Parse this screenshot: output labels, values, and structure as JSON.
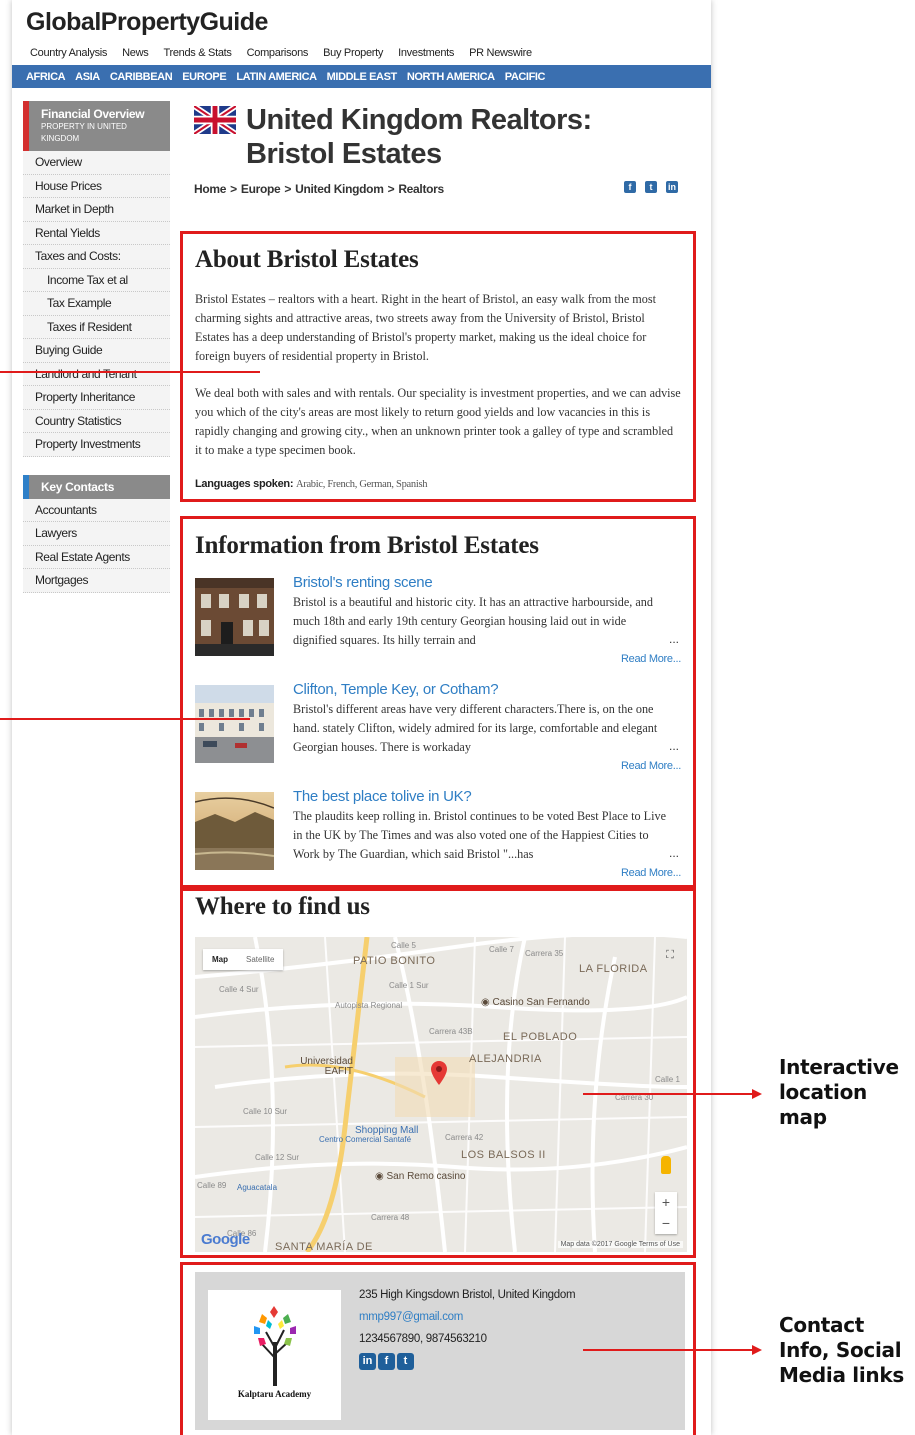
{
  "site": {
    "logo": "GlobalPropertyGuide"
  },
  "top_nav": [
    "Country Analysis",
    "News",
    "Trends & Stats",
    "Comparisons",
    "Buy Property",
    "Investments",
    "PR Newswire"
  ],
  "regions": [
    "AFRICA",
    "ASIA",
    "CARIBBEAN",
    "EUROPE",
    "LATIN AMERICA",
    "MIDDLE EAST",
    "NORTH AMERICA",
    "PACIFIC"
  ],
  "sidebar": {
    "financial_title": "Financial Overview",
    "financial_sub": "PROPERTY IN UNITED KINGDOM",
    "items": [
      "Overview",
      "House Prices",
      "Market in Depth",
      "Rental Yields",
      "Taxes and Costs:",
      "Income Tax et al",
      "Tax Example",
      "Taxes if Resident",
      "Buying Guide",
      "Landlord and Tenant",
      "Property Inheritance",
      "Country Statistics",
      "Property Investments"
    ],
    "contacts_title": "Key Contacts",
    "contacts": [
      "Accountants",
      "Lawyers",
      "Real Estate Agents",
      "Mortgages"
    ]
  },
  "page": {
    "title": "United Kingdom Realtors: Bristol Estates",
    "breadcrumb": [
      "Home",
      ">",
      "Europe",
      ">",
      "United Kingdom",
      ">",
      "Realtors"
    ],
    "share_icons": [
      "facebook-icon",
      "twitter-icon",
      "linkedin-icon"
    ]
  },
  "about": {
    "heading": "About Bristol Estates",
    "p1": "Bristol Estates – realtors with a heart. Right in the heart of Bristol, an easy walk from the most charming sights and attractive areas, two streets away from the University of Bristol, Bristol Estates has a deep understanding of Bristol's property market, making us the ideal choice for foreign buyers of residential property in Bristol.",
    "p2": "We deal both with sales and with rentals. Our speciality is investment properties, and we can advise you which of the city's areas are most likely to return good yields and low vacancies in this is rapidly changing and growing city., when an unknown printer took a galley of type and scrambled it to make a type specimen book.",
    "languages_label": "Languages spoken:",
    "languages": "Arabic, French, German, Spanish"
  },
  "info": {
    "heading": "Information from Bristol Estates",
    "articles": [
      {
        "title": "Bristol's renting scene",
        "text": "Bristol is a beautiful and historic city.  It has an attractive harbourside, and much 18th and early 19th century Georgian housing laid out in wide dignified squares. Its hilly terrain and",
        "dots": "...",
        "more": "Read More..."
      },
      {
        "title": "Clifton, Temple Key, or Cotham?",
        "text": "Bristol's different areas have very different characters.There is, on the one hand. stately Clifton, widely admired for its large, comfortable and elegant Georgian houses.  There is workaday",
        "dots": "...",
        "more": "Read More..."
      },
      {
        "title": "The best place tolive in UK?",
        "text": "The plaudits keep rolling in.  Bristol continues to be voted Best Place to Live in the UK by The Times and was also voted one of the Happiest Cities to Work by The Guardian, which said Bristol \"...has",
        "dots": "...",
        "more": "Read More..."
      }
    ]
  },
  "find": {
    "heading": "Where to find us",
    "map_type": [
      "Map",
      "Satellite"
    ],
    "areas": [
      "PATIO BONITO",
      "LA FLORIDA",
      "EL POBLADO",
      "ALEJANDRIA",
      "LOS BALSOS II",
      "SANTA MARÍA DE"
    ],
    "pois": [
      "Casino San Fernando",
      "Universidad EAFIT",
      "Shopping Mall",
      "Centro Comercial Santafé",
      "San Remo casino",
      "Aguacatala"
    ],
    "streets": [
      "Calle 5",
      "Calle 7",
      "Calle 4 Sur",
      "Calle 1 Sur",
      "Calle 10 Sur",
      "Calle 12 Sur",
      "Calle 89",
      "Calle 86",
      "Carrera 43B",
      "Carrera 42",
      "Carrera 48",
      "Autopista Regional",
      "Carrera 35",
      "Carrera 30",
      "Calle 1"
    ],
    "zoom": [
      "+",
      "−"
    ],
    "google": "Google",
    "attribution": "Map data ©2017 Google    Terms of Use"
  },
  "contact": {
    "address": "235 High Kingsdown Bristol, United Kingdom",
    "email": "mmp997@gmail.com",
    "phones": "1234567890, 9874563210",
    "logo_text": "Kalptaru Academy",
    "social": [
      "in",
      "f",
      "t"
    ]
  },
  "annotations": [
    "Interactive location map",
    "Contact Info, Social Media links"
  ],
  "colors": {
    "region_bar": "#3a6fb0",
    "highlight_red": "#e01b1b",
    "link_blue": "#2f7ec4",
    "sidebar_head": "#8a8a8a"
  }
}
